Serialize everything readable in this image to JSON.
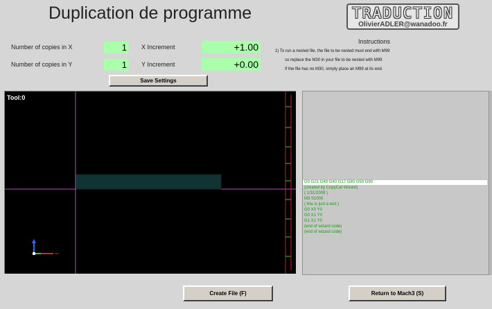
{
  "title": "Duplication de programme",
  "logo": {
    "main": "TRADUCTION",
    "sub": "OlivierADLER@wanadoo.fr"
  },
  "settings": {
    "copies_x_label": "Number of copies in X",
    "copies_x_value": "1",
    "x_increment_label": "X Increment",
    "x_increment_value": "+1.00",
    "copies_y_label": "Number of copies in Y",
    "copies_y_value": "1",
    "y_increment_label": "Y Increment",
    "y_increment_value": "+0.00",
    "save_label": "Save Settings"
  },
  "instructions": {
    "title": "Instructions",
    "lines": [
      "1) To run a nested file, the file to be nested must end with M99",
      "so replace the M30 in your file to be nested with M99",
      "If the file has no M30, simply place an M99 at its end."
    ]
  },
  "toolpath": {
    "tool_label": "Tool:0"
  },
  "gcode": {
    "lines": [
      "G0 G21 G49 G40  G17 G80 G50 G90",
      "(created by CopyCat Wizard)",
      "( 1/31/2009 )",
      "M3 S1000",
      "( this is just a test )",
      "G0 X0 Y0",
      "G0 X1 Y0",
      "G1 X1 Y0",
      "(end of wizard code)",
      "(end of wizard code)"
    ]
  },
  "buttons": {
    "create_file": "Create File (F)",
    "return_mach3": "Return to Mach3 (S)"
  },
  "colors": {
    "field_bg": "#aaffaa",
    "gcode_text": "#159a15",
    "crosshair": "#cc44cc",
    "toolpath_bg": "#000000"
  }
}
